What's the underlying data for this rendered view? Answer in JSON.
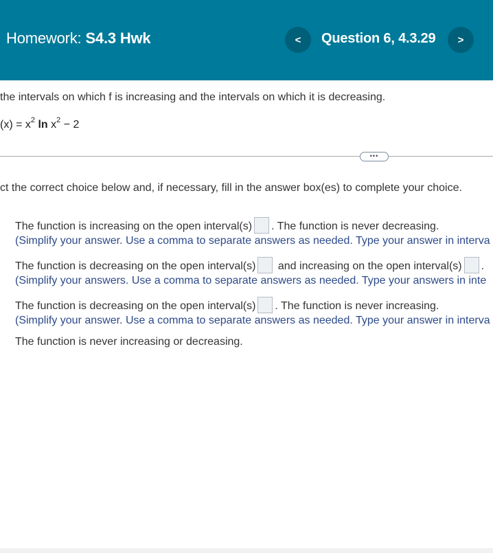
{
  "header": {
    "homework_prefix": "Homework:",
    "homework_name": "S4.3 Hwk",
    "prev_label": "<",
    "next_label": ">",
    "question_label": "Question 6, 4.3.29"
  },
  "question": {
    "prompt": "the intervals on which f is increasing and the intervals on which it is decreasing.",
    "function_lhs": "(x) = x",
    "function_exp1": "2",
    "function_ln": "ln",
    "function_x": " x",
    "function_exp2": "2",
    "function_rest": " − 2",
    "more_label": "•••",
    "instruction": "ct the correct choice below and, if necessary, fill in the answer box(es) to complete your choice."
  },
  "choices": [
    {
      "letter": ".",
      "text_before": "The function is increasing on the open interval(s)",
      "text_after": ". The function is never decreasing.",
      "hint": "(Simplify your answer. Use a comma to separate answers as needed. Type your answer in interva"
    },
    {
      "letter": ".",
      "text_before": "The function is decreasing on the open interval(s)",
      "text_middle": "and increasing on the open interval(s)",
      "text_after": ".",
      "hint": "(Simplify your answers. Use a comma to separate answers as needed. Type your answers in inte"
    },
    {
      "letter": ".",
      "text_before": "The function is decreasing on the open interval(s)",
      "text_after": ". The function is never increasing.",
      "hint": "(Simplify your answer. Use a comma to separate answers as needed. Type your answer in interva"
    },
    {
      "letter": ".",
      "text": "The function is never increasing or decreasing."
    }
  ]
}
